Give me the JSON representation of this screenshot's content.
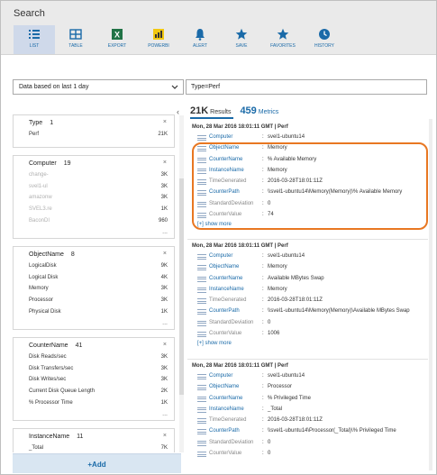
{
  "header": {
    "title": "Search"
  },
  "toolbar": [
    {
      "label": "LIST",
      "icon": "list-icon",
      "active": true
    },
    {
      "label": "TABLE",
      "icon": "table-icon"
    },
    {
      "label": "EXPORT",
      "icon": "excel-icon"
    },
    {
      "label": "POWERBI",
      "icon": "powerbi-icon"
    },
    {
      "label": "ALERT",
      "icon": "alert-bell-icon"
    },
    {
      "label": "SAVE",
      "icon": "star-icon"
    },
    {
      "label": "FAVORITES",
      "icon": "star-icon"
    },
    {
      "label": "HISTORY",
      "icon": "clock-icon"
    }
  ],
  "time_filter": {
    "label": "Data based on last 1 day"
  },
  "query": {
    "value": "Type=Perf"
  },
  "results": {
    "count": "21K",
    "count_label": "Results",
    "metrics": "459",
    "metrics_label": "Metrics"
  },
  "facets": [
    {
      "name": "Type",
      "count": "1",
      "rows": [
        {
          "label": "Perf",
          "value": "21K"
        }
      ],
      "more": false
    },
    {
      "name": "Computer",
      "count": "19",
      "rows": [
        {
          "label": "change-",
          "value": "3K",
          "blur": true
        },
        {
          "label": "svel1-ul",
          "value": "3K",
          "blur": true
        },
        {
          "label": "amazonw",
          "value": "3K",
          "blur": true
        },
        {
          "label": "SVEL3.re",
          "value": "1K",
          "blur": true
        },
        {
          "label": "BaconDI",
          "value": "960",
          "blur": true
        }
      ],
      "more": true
    },
    {
      "name": "ObjectName",
      "count": "8",
      "rows": [
        {
          "label": "LogicalDisk",
          "value": "9K"
        },
        {
          "label": "Logical Disk",
          "value": "4K"
        },
        {
          "label": "Memory",
          "value": "3K"
        },
        {
          "label": "Processor",
          "value": "3K"
        },
        {
          "label": "Physical Disk",
          "value": "1K"
        }
      ],
      "more": true
    },
    {
      "name": "CounterName",
      "count": "41",
      "rows": [
        {
          "label": "Disk Reads/sec",
          "value": "3K"
        },
        {
          "label": "Disk Transfers/sec",
          "value": "3K"
        },
        {
          "label": "Disk Writes/sec",
          "value": "3K"
        },
        {
          "label": "Current Disk Queue Length",
          "value": "2K"
        },
        {
          "label": "% Processor Time",
          "value": "1K"
        }
      ],
      "more": true
    },
    {
      "name": "InstanceName",
      "count": "11",
      "rows": [
        {
          "label": "_Total",
          "value": "7K"
        }
      ],
      "more": false
    }
  ],
  "add_label": "+Add",
  "records": [
    {
      "header": "Mon, 28 Mar 2016 18:01:11 GMT | Perf",
      "fields": [
        {
          "name": "Computer",
          "value": "svel1-ubuntu14"
        },
        {
          "name": "ObjectName",
          "value": "Memory"
        },
        {
          "name": "CounterName",
          "value": "% Available Memory"
        },
        {
          "name": "InstanceName",
          "value": "Memory"
        },
        {
          "name": "TimeGenerated",
          "value": "2016-03-28T18:01:11Z",
          "grey": true
        },
        {
          "name": "CounterPath",
          "value": "\\\\svel1-ubuntu14\\Memory(Memory)\\% Available Memory"
        },
        {
          "name": "StandardDeviation",
          "value": "0",
          "grey": true
        },
        {
          "name": "CounterValue",
          "value": "74",
          "grey": true
        }
      ],
      "show_more": "[+] show more"
    },
    {
      "header": "Mon, 28 Mar 2016 18:01:11 GMT | Perf",
      "fields": [
        {
          "name": "Computer",
          "value": "svel1-ubuntu14"
        },
        {
          "name": "ObjectName",
          "value": "Memory"
        },
        {
          "name": "CounterName",
          "value": "Available MBytes Swap"
        },
        {
          "name": "InstanceName",
          "value": "Memory"
        },
        {
          "name": "TimeGenerated",
          "value": "2016-03-28T18:01:11Z",
          "grey": true
        },
        {
          "name": "CounterPath",
          "value": "\\\\svel1-ubuntu14\\Memory(Memory)\\Available MBytes Swap"
        },
        {
          "name": "StandardDeviation",
          "value": "0",
          "grey": true
        },
        {
          "name": "CounterValue",
          "value": "1006",
          "grey": true
        }
      ],
      "show_more": "[+] show more"
    },
    {
      "header": "Mon, 28 Mar 2016 18:01:11 GMT | Perf",
      "fields": [
        {
          "name": "Computer",
          "value": "svel1-ubuntu14"
        },
        {
          "name": "ObjectName",
          "value": "Processor"
        },
        {
          "name": "CounterName",
          "value": "% Privileged Time"
        },
        {
          "name": "InstanceName",
          "value": "_Total"
        },
        {
          "name": "TimeGenerated",
          "value": "2016-03-28T18:01:11Z",
          "grey": true
        },
        {
          "name": "CounterPath",
          "value": "\\\\svel1-ubuntu14\\Processor(_Total)\\% Privileged Time"
        },
        {
          "name": "StandardDeviation",
          "value": "0",
          "grey": true
        },
        {
          "name": "CounterValue",
          "value": "0",
          "grey": true
        }
      ],
      "show_more": ""
    }
  ],
  "colors": {
    "accent": "#1a6aa8",
    "highlight": "#e87722"
  }
}
